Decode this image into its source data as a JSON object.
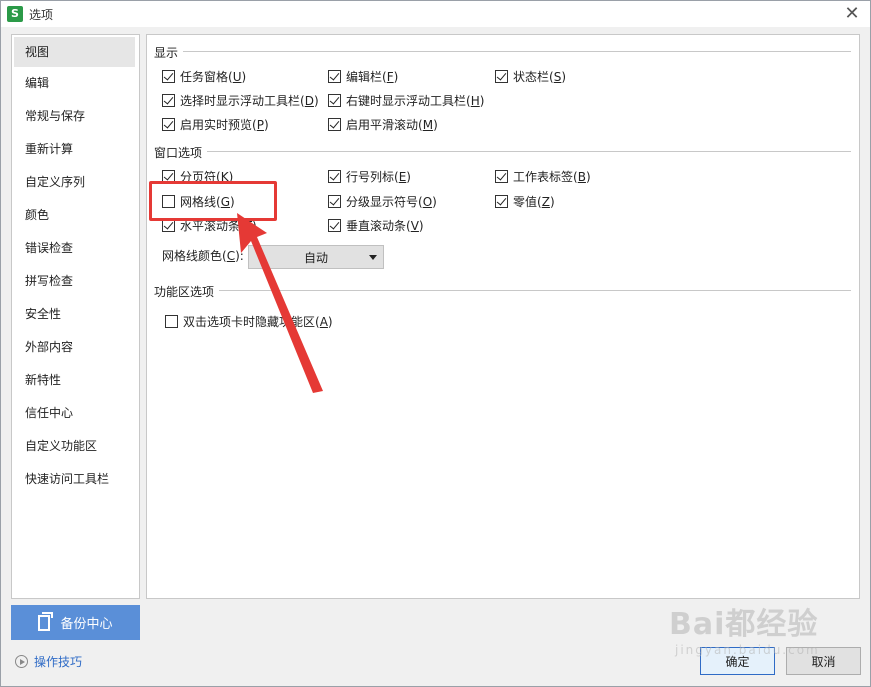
{
  "window": {
    "title": "选项",
    "app_icon_letter": "S",
    "close_glyph": "✕"
  },
  "sidebar": {
    "items": [
      {
        "label": "视图",
        "active": true
      },
      {
        "label": "编辑"
      },
      {
        "label": "常规与保存"
      },
      {
        "label": "重新计算"
      },
      {
        "label": "自定义序列"
      },
      {
        "label": "颜色"
      },
      {
        "label": "错误检查"
      },
      {
        "label": "拼写检查"
      },
      {
        "label": "安全性"
      },
      {
        "label": "外部内容"
      },
      {
        "label": "新特性"
      },
      {
        "label": "信任中心"
      },
      {
        "label": "自定义功能区"
      },
      {
        "label": "快速访问工具栏"
      }
    ]
  },
  "backup": {
    "label": "备份中心"
  },
  "tips": {
    "label": "操作技巧"
  },
  "display": {
    "title": "显示",
    "options": [
      {
        "label": "任务窗格",
        "key": "U",
        "checked": true
      },
      {
        "label": "编辑栏",
        "key": "F",
        "checked": true
      },
      {
        "label": "状态栏",
        "key": "S",
        "checked": true
      },
      {
        "label": "选择时显示浮动工具栏",
        "key": "D",
        "checked": true
      },
      {
        "label": "右键时显示浮动工具栏",
        "key": "H",
        "checked": true
      },
      {
        "label": "启用实时预览",
        "key": "P",
        "checked": true
      },
      {
        "label": "启用平滑滚动",
        "key": "M",
        "checked": true
      }
    ]
  },
  "window_options": {
    "title": "窗口选项",
    "options": [
      {
        "label": "分页符",
        "key": "K",
        "checked": true
      },
      {
        "label": "行号列标",
        "key": "E",
        "checked": true
      },
      {
        "label": "工作表标签",
        "key": "B",
        "checked": true
      },
      {
        "label": "网格线",
        "key": "G",
        "checked": false
      },
      {
        "label": "分级显示符号",
        "key": "O",
        "checked": true
      },
      {
        "label": "零值",
        "key": "Z",
        "checked": true
      },
      {
        "label": "水平滚动条",
        "key": "T",
        "checked": true
      },
      {
        "label": "垂直滚动条",
        "key": "V",
        "checked": true
      }
    ],
    "grid_color_label": "网格线颜色",
    "grid_color_key": "C",
    "grid_color_value": "自动"
  },
  "ribbon": {
    "title": "功能区选项",
    "options": [
      {
        "label": "双击选项卡时隐藏功能区",
        "key": "A",
        "checked": false
      }
    ]
  },
  "buttons": {
    "ok": "确定",
    "cancel": "取消"
  },
  "watermark": {
    "main": "Bai都经验",
    "sub": "jingyan.baidu.com"
  },
  "colors": {
    "accent": "#5a8fd8",
    "highlight": "#e53935",
    "link": "#2f6bc6"
  }
}
